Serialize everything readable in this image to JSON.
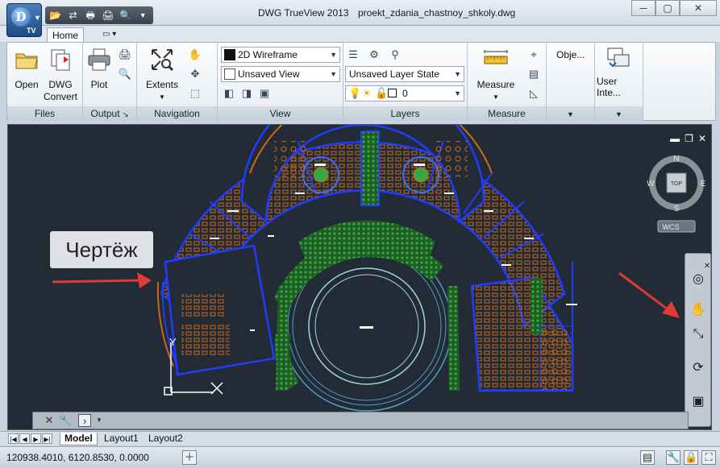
{
  "window": {
    "app_title": "DWG TrueView 2013",
    "file_name": "proekt_zdania_chastnoy_shkoly.dwg"
  },
  "app_button": {
    "logo": "D",
    "badge": "TV"
  },
  "quick_access": [
    "open-icon",
    "convert-icon",
    "plot-icon",
    "batch-plot-icon",
    "preview-icon",
    "dropdown-icon"
  ],
  "tabs": {
    "home": "Home"
  },
  "ribbon": {
    "files": {
      "label": "Files",
      "open": "Open",
      "dwg_convert_line1": "DWG",
      "dwg_convert_line2": "Convert"
    },
    "output": {
      "label": "Output",
      "plot": "Plot",
      "launcher": "↘"
    },
    "navigation": {
      "label": "Navigation",
      "extents": "Extents"
    },
    "view": {
      "label": "View",
      "visual_style": "2D Wireframe",
      "named_view": "Unsaved View"
    },
    "layers": {
      "label": "Layers",
      "layer_state": "Unsaved Layer State",
      "current_layer": "0"
    },
    "measure": {
      "label": "Measure",
      "measure": "Measure"
    },
    "objects": {
      "label": "Obje..."
    },
    "user_interface": {
      "label": "User Inte..."
    }
  },
  "viewport": {
    "callout": "Чертёж",
    "viewcube": {
      "top": "TOP",
      "n": "N",
      "s": "S",
      "e": "E",
      "w": "W",
      "wcs": "WCS"
    },
    "ucs_y": "Y"
  },
  "layout_tabs": [
    "Model",
    "Layout1",
    "Layout2"
  ],
  "status": {
    "coordinates": "120938.4010, 6120.8530, 0.0000"
  },
  "colors": {
    "canvas": "#232b37",
    "walls": "#1f3cff",
    "furniture": "#c86a14",
    "greenery": "#2f8f2f",
    "annotation_arrow": "#e23b35"
  }
}
